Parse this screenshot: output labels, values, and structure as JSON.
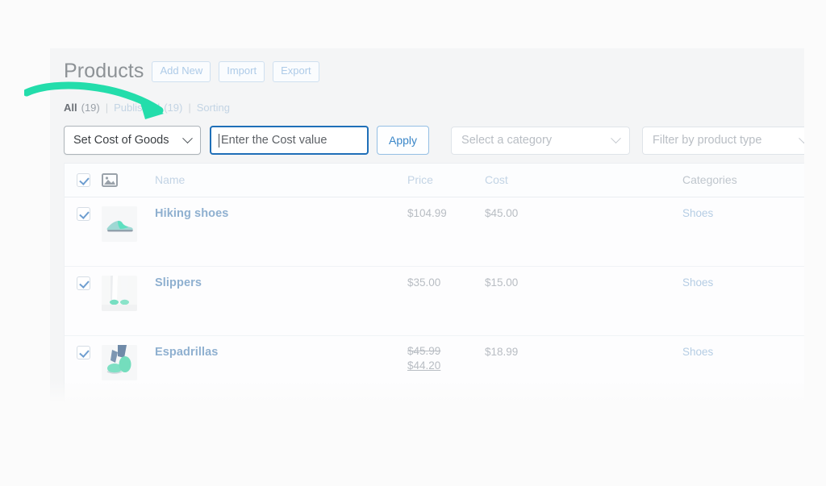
{
  "theme": {
    "page_bg": "#fbfbfb",
    "panel_bg": "#f4f5f6",
    "accent_blue": "#1f6fb8",
    "link_blue": "#8fb0d0",
    "arrow_green": "#23ddab"
  },
  "header": {
    "title": "Products",
    "buttons": [
      {
        "label": "Add New",
        "name": "add-new-button"
      },
      {
        "label": "Import",
        "name": "import-button"
      },
      {
        "label": "Export",
        "name": "export-button"
      }
    ]
  },
  "status_filters": {
    "all_label": "All",
    "all_count": "(19)",
    "sep1": "|",
    "published_label": "Published",
    "published_count": "(19)",
    "sep2": "|",
    "sorting_label": "Sorting"
  },
  "bulk_actions": {
    "action_select": "Set Cost of Goods",
    "cost_input_placeholder": "Enter the Cost value",
    "cost_input_value": "",
    "apply_label": "Apply",
    "category_select": "Select a category",
    "product_type_select": "Filter by product type"
  },
  "table": {
    "columns": {
      "image": "image-placeholder-icon",
      "name": "Name",
      "price": "Price",
      "cost": "Cost",
      "categories": "Categories"
    },
    "select_all_checked": true,
    "rows": [
      {
        "checked": true,
        "name": "Hiking shoes",
        "price": "$104.99",
        "price_sale": "",
        "cost": "$45.00",
        "category": "Shoes",
        "thumb": "sneaker"
      },
      {
        "checked": true,
        "name": "Slippers",
        "price": "$35.00",
        "price_sale": "",
        "cost": "$15.00",
        "category": "Shoes",
        "thumb": "slippers"
      },
      {
        "checked": true,
        "name": "Espadrillas",
        "price": "$45.99",
        "price_sale": "$44.20",
        "cost": "$18.99",
        "category": "Shoes",
        "thumb": "espadrilles"
      }
    ]
  },
  "annotation": {
    "arrow": "curved-arrow-pointing-to-cost-input"
  }
}
